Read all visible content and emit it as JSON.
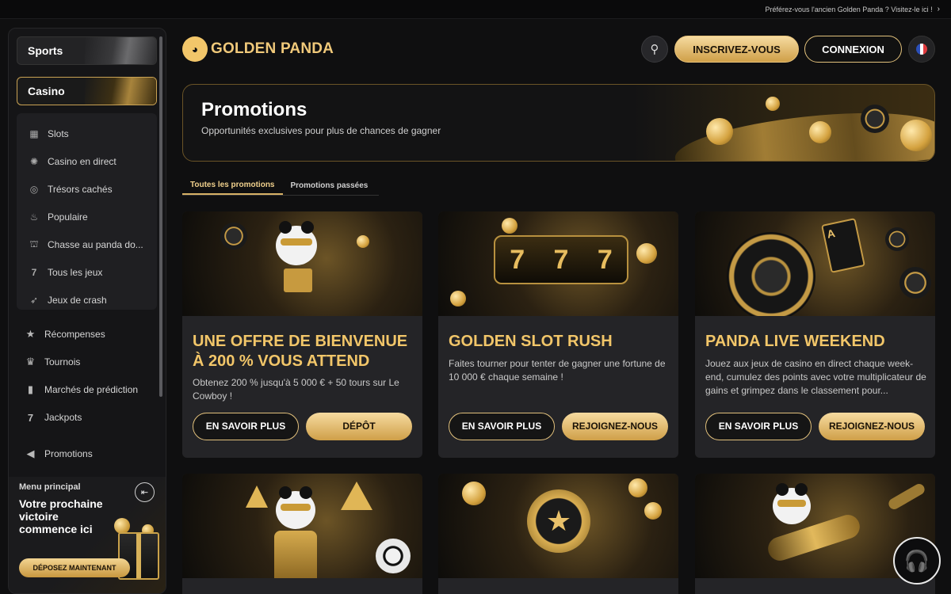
{
  "topbar": {
    "notice": "Préférez-vous l'ancien Golden Panda ? Visitez-le ici !"
  },
  "sidebar": {
    "sports": "Sports",
    "casino": "Casino",
    "casino_items": [
      "Slots",
      "Casino en direct",
      "Trésors cachés",
      "Populaire",
      "Chasse au panda do...",
      "Tous les jeux",
      "Jeux de crash"
    ],
    "main_items": [
      "Récompenses",
      "Tournois",
      "Marchés de prédiction",
      "Jackpots",
      "Promotions"
    ],
    "promo": {
      "label": "Menu principal",
      "headline": "Votre prochaine victoire commence ici",
      "cta": "DÉPOSEZ MAINTENANT"
    }
  },
  "header": {
    "brand": "GOLDEN PANDA",
    "register": "INSCRIVEZ-VOUS",
    "login": "CONNEXION"
  },
  "hero": {
    "title": "Promotions",
    "subtitle": "Opportunités exclusives pour plus de chances de gagner"
  },
  "tabs": [
    "Toutes les promotions",
    "Promotions passées"
  ],
  "cards": [
    {
      "title": "UNE OFFRE DE BIENVENUE À 200 % VOUS ATTEND",
      "description": "Obtenez 200 % jusqu'à 5 000 € + 50 tours sur Le Cowboy !",
      "more": "EN SAVOIR PLUS",
      "action": "DÉPÔT"
    },
    {
      "title": "GOLDEN SLOT RUSH",
      "description": "Faites tourner pour tenter de gagner une fortune de 10 000 € chaque semaine !",
      "more": "EN SAVOIR PLUS",
      "action": "REJOIGNEZ-NOUS"
    },
    {
      "title": "PANDA LIVE WEEKEND",
      "description": "Jouez aux jeux de casino en direct chaque week-end, cumulez des points avec votre multiplicateur de gains et grimpez dans le classement pour...",
      "more": "EN SAVOIR PLUS",
      "action": "REJOIGNEZ-NOUS"
    }
  ],
  "colors": {
    "gold": "#f2c669",
    "gold_button": "#cf9f48",
    "background": "#0f0f10",
    "card": "#242427"
  },
  "icons": {
    "casino_items": [
      "slot-machine-icon",
      "live-casino-icon",
      "treasure-icon",
      "flame-icon",
      "panda-hunt-icon",
      "seven-icon",
      "rocket-icon"
    ],
    "main_items": [
      "star-icon",
      "trophy-icon",
      "bar-chart-icon",
      "seven-icon",
      "megaphone-icon"
    ]
  }
}
